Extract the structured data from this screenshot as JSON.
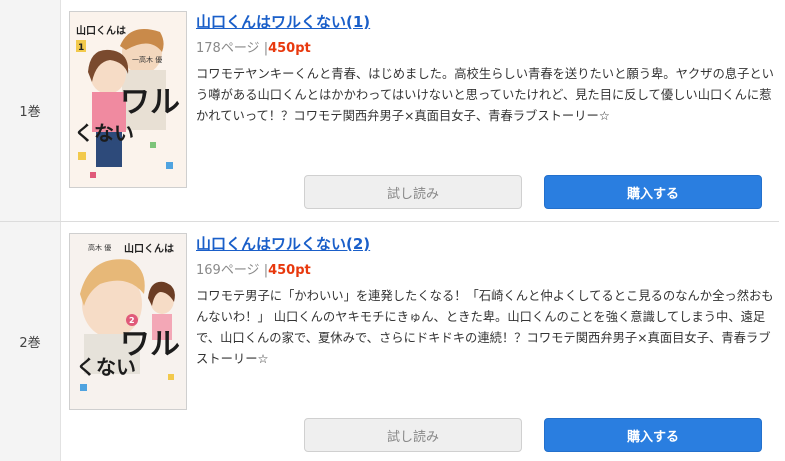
{
  "volumes": [
    {
      "volume_label": "1巻",
      "title": "山口くんはワルくない(1)",
      "pages": "178ページ",
      "separator": "|",
      "price": "450pt",
      "description": "コワモテヤンキーくんと青春、はじめました。高校生らしい青春を送りたいと願う卑。ヤクザの息子という噂がある山口くんとはかかわってはいけないと思っていたけれど、見た目に反して優しい山口くんに惹かれていって！？コワモテ関西弁男子×真面目女子、青春ラブストーリー☆",
      "cover": {
        "title_text": "山口くんは",
        "big_text": "ワル",
        "sub_text": "くない",
        "vol_mark": "1",
        "author": "一高木 優"
      },
      "trial_button": "試し読み",
      "buy_button": "購入する"
    },
    {
      "volume_label": "2巻",
      "title": "山口くんはワルくない(2)",
      "pages": "169ページ",
      "separator": "|",
      "price": "450pt",
      "description": "コワモテ男子に「かわいい」を連発したくなる！「石崎くんと仲よくしてるとこ見るのなんか全っ然おもんないわ！」 山口くんのヤキモチにきゅん、ときた卑。山口くんのことを強く意識してしまう中、遠足で、山口くんの家で、夏休みで、さらにドキドキの連続！？コワモテ関西弁男子×真面目女子、青春ラブストーリー☆",
      "cover": {
        "title_text": "山口くんは",
        "big_text": "ワル",
        "sub_text": "くない",
        "vol_mark": "2",
        "author": "高木 優"
      },
      "trial_button": "試し読み",
      "buy_button": "購入する"
    }
  ],
  "colors": {
    "link": "#1a5fc9",
    "price": "#e8380d",
    "buy_button": "#2a7ee0",
    "trial_button": "#efefef"
  }
}
